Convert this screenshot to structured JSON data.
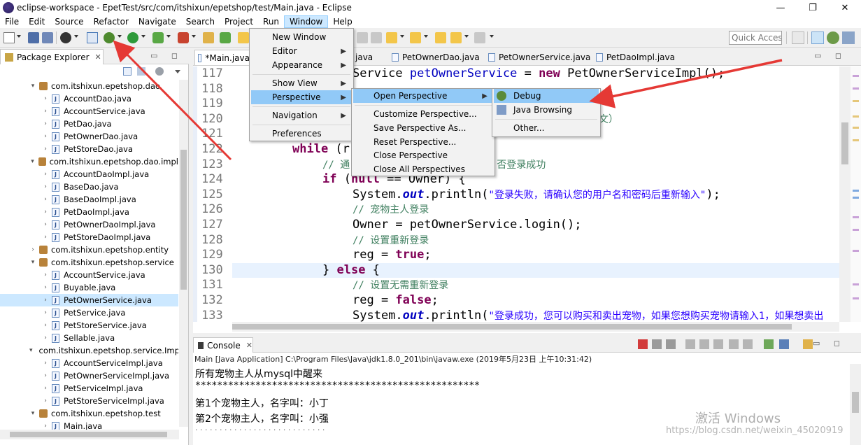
{
  "window": {
    "title": "eclipse-workspace - EpetTest/src/com/itshixun/epetshop/test/Main.java - Eclipse",
    "minimize": "—",
    "maximize": "❐",
    "close": "✕"
  },
  "menubar": [
    "File",
    "Edit",
    "Source",
    "Refactor",
    "Navigate",
    "Search",
    "Project",
    "Run",
    "Window",
    "Help"
  ],
  "toolbar": {
    "quick_access": "Quick Access"
  },
  "package_explorer": {
    "title": "Package Explorer",
    "close": "✕",
    "tree": [
      {
        "kind": "pkg",
        "label": "com.itshixun.epetshop.dao",
        "twist": "▾"
      },
      {
        "kind": "file",
        "label": "AccountDao.java",
        "twist": "›"
      },
      {
        "kind": "file",
        "label": "AccountService.java",
        "twist": "›"
      },
      {
        "kind": "file",
        "label": "PetDao.java",
        "twist": "›"
      },
      {
        "kind": "file",
        "label": "PetOwnerDao.java",
        "twist": "›"
      },
      {
        "kind": "file",
        "label": "PetStoreDao.java",
        "twist": "›"
      },
      {
        "kind": "pkg",
        "label": "com.itshixun.epetshop.dao.impl",
        "twist": "▾"
      },
      {
        "kind": "file",
        "label": "AccountDaoImpl.java",
        "twist": "›"
      },
      {
        "kind": "file",
        "label": "BaseDao.java",
        "twist": "›"
      },
      {
        "kind": "file",
        "label": "BaseDaoImpl.java",
        "twist": "›"
      },
      {
        "kind": "file",
        "label": "PetDaoImpl.java",
        "twist": "›"
      },
      {
        "kind": "file",
        "label": "PetOwnerDaoImpl.java",
        "twist": "›"
      },
      {
        "kind": "file",
        "label": "PetStoreDaoImpl.java",
        "twist": "›"
      },
      {
        "kind": "pkg",
        "label": "com.itshixun.epetshop.entity",
        "twist": "›"
      },
      {
        "kind": "pkg",
        "label": "com.itshixun.epetshop.service",
        "twist": "▾"
      },
      {
        "kind": "file",
        "label": "AccountService.java",
        "twist": "›"
      },
      {
        "kind": "file",
        "label": "Buyable.java",
        "twist": "›"
      },
      {
        "kind": "file",
        "label": "PetOwnerService.java",
        "twist": "›",
        "selected": true
      },
      {
        "kind": "file",
        "label": "PetService.java",
        "twist": "›"
      },
      {
        "kind": "file",
        "label": "PetStoreService.java",
        "twist": "›"
      },
      {
        "kind": "file",
        "label": "Sellable.java",
        "twist": "›"
      },
      {
        "kind": "pkg",
        "label": "com.itshixun.epetshop.service.Impl",
        "twist": "▾"
      },
      {
        "kind": "file",
        "label": "AccountServiceImpl.java",
        "twist": "›"
      },
      {
        "kind": "file",
        "label": "PetOwnerServiceImpl.java",
        "twist": "›"
      },
      {
        "kind": "file",
        "label": "PetServiceImpl.java",
        "twist": "›"
      },
      {
        "kind": "file",
        "label": "PetStoreServiceImpl.java",
        "twist": "›"
      },
      {
        "kind": "pkg",
        "label": "com.itshixun.epetshop.test",
        "twist": "▾"
      },
      {
        "kind": "file",
        "label": "Main.java",
        "twist": "›"
      }
    ]
  },
  "editor": {
    "tabs": [
      "*Main.java",
      "java",
      "PetOwnerDao.java",
      "PetOwnerService.java",
      "PetDaoImpl.java"
    ],
    "line_numbers": [
      "117",
      "118",
      "119",
      "120",
      "121",
      "122",
      "123",
      "124",
      "125",
      "126",
      "127",
      "128",
      "129",
      "130",
      "131",
      "132",
      "133"
    ],
    "code": {
      "l117_a": "Service ",
      "l117_b": "petOwnerService",
      "l117_c": " = ",
      "l117_new": "new",
      "l117_d": " PetOwnerServiceImpl();",
      "l120_tail": "文）",
      "l122_kw": "while",
      "l122_rest": " (r",
      "l123_cm": "// 通",
      "l123_tail": "否登录成功",
      "l124_if": "if",
      "l124_a": " (",
      "l124_null": "null",
      "l124_b": " == Owner) {",
      "l125_a": "System.",
      "l125_out": "out",
      "l125_b": ".println(",
      "l125_str": "\"登录失败，请确认您的用户名和密码后重新输入\"",
      "l125_c": ");",
      "l126_cm": "// 宠物主人登录",
      "l127": "Owner = petOwnerService.login();",
      "l128_cm": "// 设置重新登录",
      "l129_a": "reg = ",
      "l129_true": "true",
      "l129_b": ";",
      "l130_a": "} ",
      "l130_else": "else",
      "l130_b": " {",
      "l131_cm": "// 设置无需重新登录",
      "l132_a": "reg = ",
      "l132_false": "false",
      "l132_b": ";",
      "l133_a": "System.",
      "l133_out": "out",
      "l133_b": ".println(",
      "l133_str": "\"登录成功，您可以购买和卖出宠物，如果您想购买宠物请输入1，如果想卖出"
    }
  },
  "console": {
    "title": "Console",
    "close": "✕",
    "description": "Main [Java Application] C:\\Program Files\\Java\\jdk1.8.0_201\\bin\\javaw.exe (2019年5月23日 上午10:31:42)",
    "lines": [
      "所有宠物主人从mysql中醒来",
      "****************************************************",
      "第1个宠物主人，名字叫：小丁",
      "第2个宠物主人，名字叫：小强",
      "· · · · · · · · · · · · · · · · · · · · · · · · · · ·"
    ],
    "watermark_title": "激活 Windows",
    "watermark_sub": "https://blog.csdn.net/weixin_45020919"
  },
  "window_menu": {
    "items": [
      "New Window",
      "Editor",
      "Appearance",
      "Show View",
      "Perspective",
      "Navigation",
      "Preferences"
    ]
  },
  "perspective_menu": {
    "items": [
      "Open Perspective",
      "Customize Perspective...",
      "Save Perspective As...",
      "Reset Perspective...",
      "Close Perspective",
      "Close All Perspectives"
    ]
  },
  "open_perspective_menu": {
    "items": [
      "Debug",
      "Java Browsing",
      "Other..."
    ]
  },
  "colors": {
    "highlight": "#91c9f7",
    "arrow": "#e53935",
    "keyword": "#7f0055",
    "comment": "#3f7f5f",
    "string": "#2a00ff"
  }
}
